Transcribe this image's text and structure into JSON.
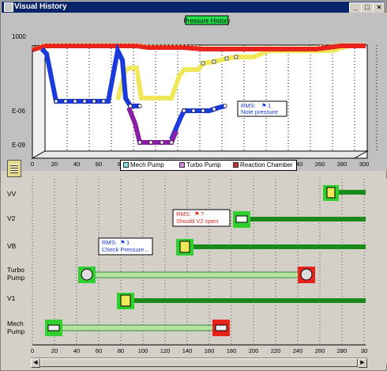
{
  "window": {
    "title": "Visual History",
    "minimize_label": "_",
    "maximize_label": "□",
    "close_label": "×"
  },
  "top_chart": {
    "title": "Pressure History",
    "y_ticks": [
      "1000",
      "E-06",
      "E-09"
    ],
    "x_ticks": [
      "0",
      "20",
      "40",
      "60",
      "80",
      "100",
      "120",
      "140",
      "160",
      "180",
      "200",
      "220",
      "240",
      "260",
      "280",
      "300"
    ],
    "legend": [
      "Mech Pump",
      "Turbo Pump",
      "Reaction Chamber"
    ],
    "note": {
      "line1": "RMS:",
      "flag": "1",
      "line2": "Note pressure"
    },
    "colors": {
      "mech": "#1a3adc",
      "turbo": "#8a1fa6",
      "reaction": "#e8231c",
      "yellow": "#f0e85a"
    }
  },
  "bottom_chart": {
    "rows": [
      {
        "label1": "VV",
        "label2": ""
      },
      {
        "label1": "V2",
        "label2": ""
      },
      {
        "label1": "VB",
        "label2": ""
      },
      {
        "label1": "Turbo",
        "label2": "Pump"
      },
      {
        "label1": "V1",
        "label2": ""
      },
      {
        "label1": "Mech",
        "label2": "Pump"
      }
    ],
    "x_ticks": [
      "0",
      "20",
      "40",
      "60",
      "80",
      "100",
      "120",
      "140",
      "160",
      "180",
      "200",
      "220",
      "240",
      "260",
      "280",
      "30"
    ],
    "note_v2": {
      "line1": "RMS:",
      "flag": "?",
      "line2": "Should V2 open"
    },
    "note_vb": {
      "line1": "RMS:",
      "flag": "1",
      "line2": "Check Pressure..."
    }
  }
}
